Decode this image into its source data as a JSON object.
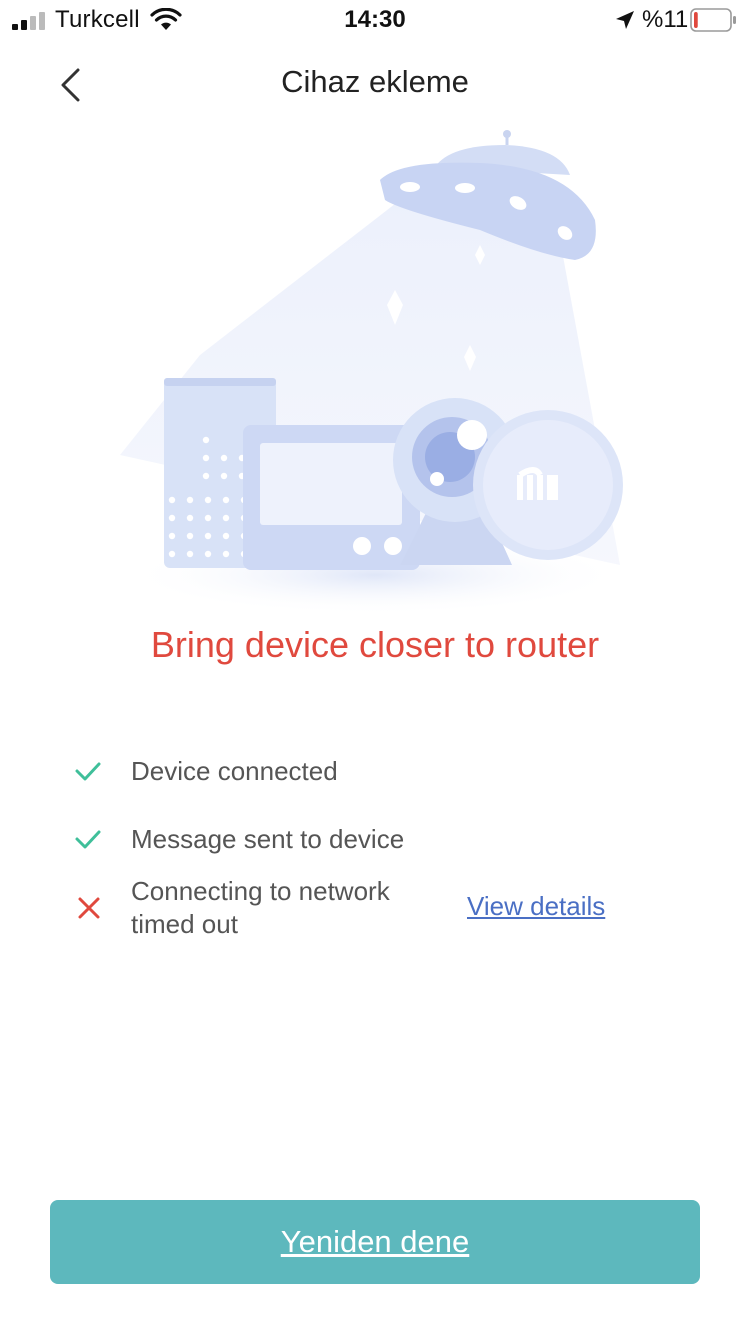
{
  "status_bar": {
    "carrier": "Turkcell",
    "time": "14:30",
    "battery_percent": "%11",
    "battery_level": 0.11,
    "battery_color": "#e0493e",
    "icons": [
      "signal-icon",
      "wifi-icon",
      "location-arrow-icon",
      "battery-icon"
    ]
  },
  "nav": {
    "back_icon": "chevron-left-icon",
    "title": "Cihaz ekleme"
  },
  "headline": "Bring device closer to router",
  "steps": [
    {
      "status": "success",
      "icon": "check-icon",
      "text": "Device connected"
    },
    {
      "status": "success",
      "icon": "check-icon",
      "text": "Message sent to device"
    },
    {
      "status": "failed",
      "icon": "cross-icon",
      "text_line1": "Connecting to network",
      "text_line2": "timed out",
      "link": "View details"
    }
  ],
  "retry_button": {
    "label": "Yeniden dene"
  },
  "colors": {
    "error": "#e0493e",
    "success": "#3fbf9a",
    "link": "#4a6fc4",
    "primary_button": "#5db8bd"
  }
}
